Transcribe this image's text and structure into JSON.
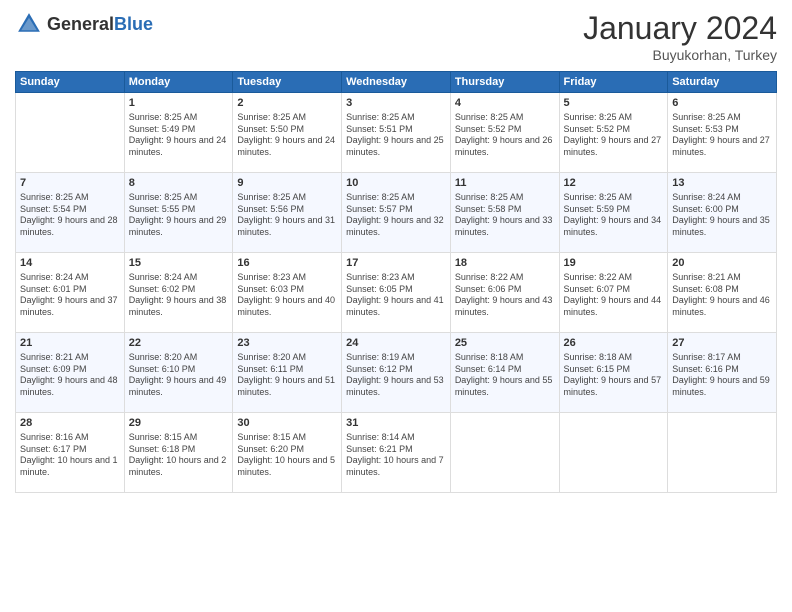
{
  "header": {
    "logo_general": "General",
    "logo_blue": "Blue",
    "month": "January 2024",
    "location": "Buyukorhan, Turkey"
  },
  "days_of_week": [
    "Sunday",
    "Monday",
    "Tuesday",
    "Wednesday",
    "Thursday",
    "Friday",
    "Saturday"
  ],
  "weeks": [
    [
      {
        "day": "",
        "sunrise": "",
        "sunset": "",
        "daylight": ""
      },
      {
        "day": "1",
        "sunrise": "Sunrise: 8:25 AM",
        "sunset": "Sunset: 5:49 PM",
        "daylight": "Daylight: 9 hours and 24 minutes."
      },
      {
        "day": "2",
        "sunrise": "Sunrise: 8:25 AM",
        "sunset": "Sunset: 5:50 PM",
        "daylight": "Daylight: 9 hours and 24 minutes."
      },
      {
        "day": "3",
        "sunrise": "Sunrise: 8:25 AM",
        "sunset": "Sunset: 5:51 PM",
        "daylight": "Daylight: 9 hours and 25 minutes."
      },
      {
        "day": "4",
        "sunrise": "Sunrise: 8:25 AM",
        "sunset": "Sunset: 5:52 PM",
        "daylight": "Daylight: 9 hours and 26 minutes."
      },
      {
        "day": "5",
        "sunrise": "Sunrise: 8:25 AM",
        "sunset": "Sunset: 5:52 PM",
        "daylight": "Daylight: 9 hours and 27 minutes."
      },
      {
        "day": "6",
        "sunrise": "Sunrise: 8:25 AM",
        "sunset": "Sunset: 5:53 PM",
        "daylight": "Daylight: 9 hours and 27 minutes."
      }
    ],
    [
      {
        "day": "7",
        "sunrise": "Sunrise: 8:25 AM",
        "sunset": "Sunset: 5:54 PM",
        "daylight": "Daylight: 9 hours and 28 minutes."
      },
      {
        "day": "8",
        "sunrise": "Sunrise: 8:25 AM",
        "sunset": "Sunset: 5:55 PM",
        "daylight": "Daylight: 9 hours and 29 minutes."
      },
      {
        "day": "9",
        "sunrise": "Sunrise: 8:25 AM",
        "sunset": "Sunset: 5:56 PM",
        "daylight": "Daylight: 9 hours and 31 minutes."
      },
      {
        "day": "10",
        "sunrise": "Sunrise: 8:25 AM",
        "sunset": "Sunset: 5:57 PM",
        "daylight": "Daylight: 9 hours and 32 minutes."
      },
      {
        "day": "11",
        "sunrise": "Sunrise: 8:25 AM",
        "sunset": "Sunset: 5:58 PM",
        "daylight": "Daylight: 9 hours and 33 minutes."
      },
      {
        "day": "12",
        "sunrise": "Sunrise: 8:25 AM",
        "sunset": "Sunset: 5:59 PM",
        "daylight": "Daylight: 9 hours and 34 minutes."
      },
      {
        "day": "13",
        "sunrise": "Sunrise: 8:24 AM",
        "sunset": "Sunset: 6:00 PM",
        "daylight": "Daylight: 9 hours and 35 minutes."
      }
    ],
    [
      {
        "day": "14",
        "sunrise": "Sunrise: 8:24 AM",
        "sunset": "Sunset: 6:01 PM",
        "daylight": "Daylight: 9 hours and 37 minutes."
      },
      {
        "day": "15",
        "sunrise": "Sunrise: 8:24 AM",
        "sunset": "Sunset: 6:02 PM",
        "daylight": "Daylight: 9 hours and 38 minutes."
      },
      {
        "day": "16",
        "sunrise": "Sunrise: 8:23 AM",
        "sunset": "Sunset: 6:03 PM",
        "daylight": "Daylight: 9 hours and 40 minutes."
      },
      {
        "day": "17",
        "sunrise": "Sunrise: 8:23 AM",
        "sunset": "Sunset: 6:05 PM",
        "daylight": "Daylight: 9 hours and 41 minutes."
      },
      {
        "day": "18",
        "sunrise": "Sunrise: 8:22 AM",
        "sunset": "Sunset: 6:06 PM",
        "daylight": "Daylight: 9 hours and 43 minutes."
      },
      {
        "day": "19",
        "sunrise": "Sunrise: 8:22 AM",
        "sunset": "Sunset: 6:07 PM",
        "daylight": "Daylight: 9 hours and 44 minutes."
      },
      {
        "day": "20",
        "sunrise": "Sunrise: 8:21 AM",
        "sunset": "Sunset: 6:08 PM",
        "daylight": "Daylight: 9 hours and 46 minutes."
      }
    ],
    [
      {
        "day": "21",
        "sunrise": "Sunrise: 8:21 AM",
        "sunset": "Sunset: 6:09 PM",
        "daylight": "Daylight: 9 hours and 48 minutes."
      },
      {
        "day": "22",
        "sunrise": "Sunrise: 8:20 AM",
        "sunset": "Sunset: 6:10 PM",
        "daylight": "Daylight: 9 hours and 49 minutes."
      },
      {
        "day": "23",
        "sunrise": "Sunrise: 8:20 AM",
        "sunset": "Sunset: 6:11 PM",
        "daylight": "Daylight: 9 hours and 51 minutes."
      },
      {
        "day": "24",
        "sunrise": "Sunrise: 8:19 AM",
        "sunset": "Sunset: 6:12 PM",
        "daylight": "Daylight: 9 hours and 53 minutes."
      },
      {
        "day": "25",
        "sunrise": "Sunrise: 8:18 AM",
        "sunset": "Sunset: 6:14 PM",
        "daylight": "Daylight: 9 hours and 55 minutes."
      },
      {
        "day": "26",
        "sunrise": "Sunrise: 8:18 AM",
        "sunset": "Sunset: 6:15 PM",
        "daylight": "Daylight: 9 hours and 57 minutes."
      },
      {
        "day": "27",
        "sunrise": "Sunrise: 8:17 AM",
        "sunset": "Sunset: 6:16 PM",
        "daylight": "Daylight: 9 hours and 59 minutes."
      }
    ],
    [
      {
        "day": "28",
        "sunrise": "Sunrise: 8:16 AM",
        "sunset": "Sunset: 6:17 PM",
        "daylight": "Daylight: 10 hours and 1 minute."
      },
      {
        "day": "29",
        "sunrise": "Sunrise: 8:15 AM",
        "sunset": "Sunset: 6:18 PM",
        "daylight": "Daylight: 10 hours and 2 minutes."
      },
      {
        "day": "30",
        "sunrise": "Sunrise: 8:15 AM",
        "sunset": "Sunset: 6:20 PM",
        "daylight": "Daylight: 10 hours and 5 minutes."
      },
      {
        "day": "31",
        "sunrise": "Sunrise: 8:14 AM",
        "sunset": "Sunset: 6:21 PM",
        "daylight": "Daylight: 10 hours and 7 minutes."
      },
      {
        "day": "",
        "sunrise": "",
        "sunset": "",
        "daylight": ""
      },
      {
        "day": "",
        "sunrise": "",
        "sunset": "",
        "daylight": ""
      },
      {
        "day": "",
        "sunrise": "",
        "sunset": "",
        "daylight": ""
      }
    ]
  ]
}
